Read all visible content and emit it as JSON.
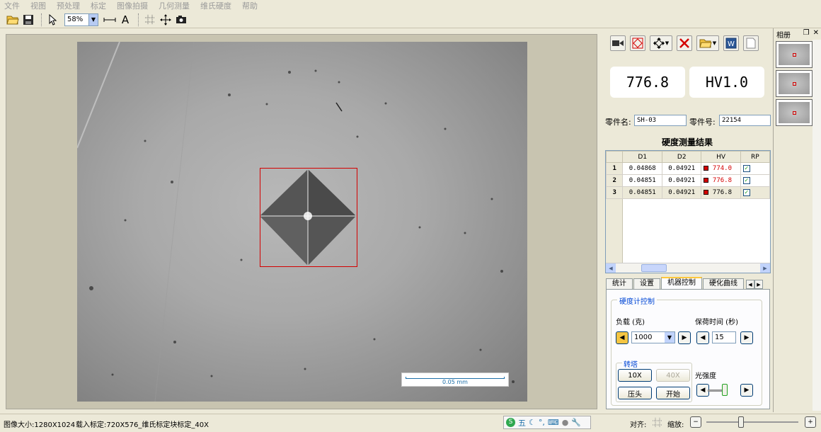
{
  "menu": [
    "文件",
    "视图",
    "预处理",
    "标定",
    "图像拍摄",
    "几何测量",
    "维氏硬度",
    "帮助"
  ],
  "toolbar": {
    "zoom_value": "58%",
    "text_tool_label": "A"
  },
  "image": {
    "scale_label": "0.05 mm"
  },
  "readout": {
    "hardness_value": "776.8",
    "hardness_scale": "HV1.0"
  },
  "part": {
    "name_label": "零件名:",
    "name_value": "SH-03",
    "number_label": "零件号:",
    "number_value": "22154"
  },
  "results": {
    "title": "硬度测量结果",
    "columns": [
      "",
      "D1",
      "D2",
      "HV",
      "RP"
    ],
    "rows": [
      {
        "index": "1",
        "d1": "0.04868",
        "d2": "0.04921",
        "hv": "774.0",
        "hv_color": "#d40000",
        "rp": "✓"
      },
      {
        "index": "2",
        "d1": "0.04851",
        "d2": "0.04921",
        "hv": "776.8",
        "hv_color": "#d40000",
        "rp": "✓"
      },
      {
        "index": "3",
        "d1": "0.04851",
        "d2": "0.04921",
        "hv": "776.8",
        "hv_color": "#000000",
        "rp": "✓"
      }
    ]
  },
  "tabs": [
    {
      "label": "统计",
      "active": false
    },
    {
      "label": "设置",
      "active": false
    },
    {
      "label": "机器控制",
      "active": true
    },
    {
      "label": "硬化曲线",
      "active": false
    }
  ],
  "machine_control": {
    "group_title": "硬度计控制",
    "load_label": "负载 (克)",
    "load_value": "1000",
    "dwell_label": "保荷时间 (秒)",
    "dwell_value": "15",
    "turret_title": "转塔",
    "objective_10x": "10X",
    "objective_40x": "40X",
    "indenter_button": "压头",
    "start_button": "开始",
    "light_label": "光强度",
    "light_level_percent": 85
  },
  "album": {
    "title": "相册",
    "thumb_count": 3
  },
  "status": {
    "image_size": "图像大小:1280X1024",
    "calibration": "载入标定:720X576_维氏标定块标定_40X",
    "align_label": "对齐:",
    "zoom_label": "缩放:",
    "ime_mode": "五"
  },
  "colors": {
    "accent_red": "#d40000",
    "link_blue": "#0046d5",
    "panel_bg": "#ece9d8"
  }
}
